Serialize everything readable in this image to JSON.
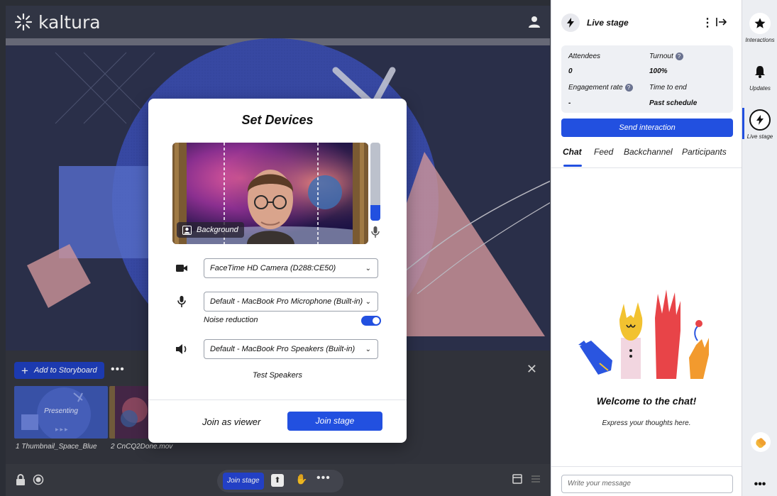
{
  "header": {
    "brand": "kaltura",
    "user_icon": "user-icon"
  },
  "storyboard": {
    "add_label": "Add to Storyboard",
    "more_label": "•••",
    "close_label": "✕",
    "items": [
      {
        "label": "1 Thumbnail_Space_Blue",
        "status": "Presenting"
      },
      {
        "label": "2 CnCQ2Done.mov"
      }
    ]
  },
  "toolbar": {
    "join_stage_label": "Join stage",
    "more_label": "•••"
  },
  "modal": {
    "title": "Set Devices",
    "background_label": "Background",
    "mic_level": 0.2,
    "camera": "FaceTime HD Camera (D288:CE50)",
    "microphone": "Default - MacBook Pro Microphone (Built-in)",
    "noise_reduction_label": "Noise reduction",
    "noise_reduction_on": true,
    "speakers": "Default - MacBook Pro Speakers (Built-in)",
    "test_speakers_label": "Test Speakers",
    "join_viewer_label": "Join as viewer",
    "join_stage_label": "Join stage"
  },
  "panel": {
    "title": "Live stage",
    "stats": {
      "attendees_label": "Attendees",
      "attendees_value": "0",
      "turnout_label": "Turnout",
      "turnout_value": "100%",
      "engagement_label": "Engagement rate",
      "engagement_value": "-",
      "time_label": "Time to end",
      "time_value": "Past schedule"
    },
    "send_interaction_label": "Send interaction",
    "tabs": [
      "Chat",
      "Feed",
      "Backchannel",
      "Participants"
    ],
    "welcome_title": "Welcome to the chat!",
    "welcome_sub": "Express your thoughts here.",
    "message_placeholder": "Write your message"
  },
  "rail": {
    "items": [
      {
        "label": "Interactions",
        "icon": "star-icon"
      },
      {
        "label": "Updates",
        "icon": "bell-icon"
      },
      {
        "label": "Live stage",
        "icon": "bolt-icon"
      }
    ],
    "more_label": "•••"
  },
  "colors": {
    "accent": "#2250e0",
    "stage_bg": "#2e3350"
  }
}
